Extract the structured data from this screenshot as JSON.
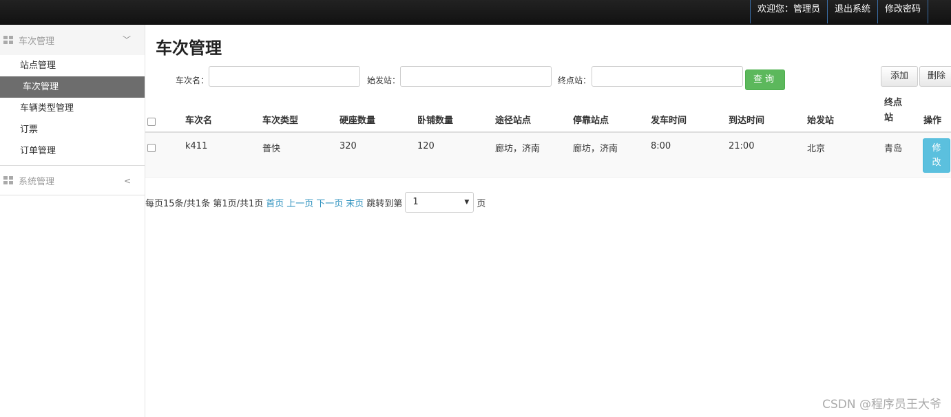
{
  "topbar": {
    "welcome": "欢迎您：管理员",
    "logout": "退出系统",
    "change_password": "修改密码"
  },
  "sidebar": {
    "group1": {
      "label": "车次管理",
      "chevron": "chevron-down-icon"
    },
    "items": [
      "站点管理",
      "车次管理",
      "车辆类型管理",
      "订票",
      "订单管理"
    ],
    "group2": {
      "label": "系统管理",
      "chevron": "chevron-left-icon"
    }
  },
  "main": {
    "title": "车次管理",
    "search": {
      "train_name_label": "车次名：",
      "start_station_label": "始发站：",
      "end_station_label": "终点站：",
      "query_button": "查询",
      "add_button": "添加",
      "delete_button": "删除"
    },
    "table": {
      "headers": [
        "车次名",
        "车次类型",
        "硬座数量",
        "卧铺数量",
        "途径站点",
        "停靠站点",
        "发车时间",
        "到达时间",
        "始发站",
        "终点站",
        "操作"
      ],
      "rows": [
        [
          "k411",
          "普快",
          "320",
          "120",
          "廊坊，济南",
          "廊坊，济南",
          "8:00",
          "21:00",
          "北京",
          "青岛"
        ]
      ],
      "edit_button": "修改"
    },
    "pager": {
      "summary": "每页15条/共1条 第1页/共1页",
      "first": "首页",
      "prev": "上一页",
      "next": "下一页",
      "last": "末页",
      "jump_label": "跳转到第",
      "selected_page": "1",
      "page_suffix": "页"
    }
  },
  "watermark": "CSDN @程序员王大爷",
  "colors": {
    "query": "#5cb85c",
    "edit": "#5bc0de",
    "active_item": "#6d6d6d",
    "link": "#2a8fbd"
  }
}
